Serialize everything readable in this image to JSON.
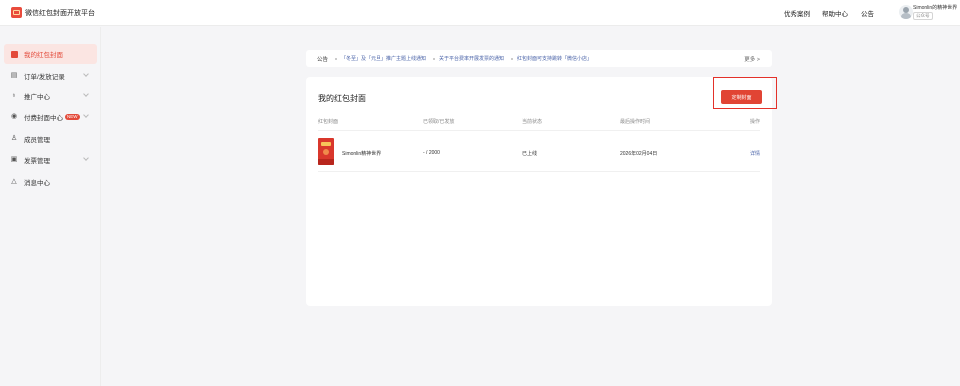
{
  "header": {
    "brand": "微信红包封面开放平台",
    "nav": [
      "优秀案例",
      "帮助中心",
      "公告"
    ],
    "user": {
      "name": "Simonlin的精神世界",
      "tag": "公众号"
    }
  },
  "sidebar": {
    "items": [
      {
        "label": "我的红包封面",
        "icon": "red-packet-icon",
        "active": true
      },
      {
        "label": "订单/发放记录",
        "icon": "document-icon",
        "expandable": true
      },
      {
        "label": "推广中心",
        "icon": "promo-icon",
        "expandable": true
      },
      {
        "label": "付费封面中心",
        "icon": "coin-icon",
        "expandable": true,
        "badge": "NEW"
      },
      {
        "label": "成员管理",
        "icon": "members-icon"
      },
      {
        "label": "发票管理",
        "icon": "invoice-icon",
        "expandable": true
      },
      {
        "label": "消息中心",
        "icon": "bell-icon"
      }
    ]
  },
  "notice": {
    "label": "公告",
    "items": [
      "「冬至」及「元旦」推广主题上线通知",
      "关于平台费率开展发票的通知",
      "红包封面可支持跳转「微信小店」"
    ],
    "more": "更多 >"
  },
  "main": {
    "title": "我的红包封面",
    "create_button": "定制封面",
    "columns": [
      "红包封面",
      "已领取/已发放",
      "当前状态",
      "最后操作时间",
      "操作"
    ],
    "rows": [
      {
        "name": "Simonlin精神世界",
        "claimed": "- / 2000",
        "status": "已上线",
        "time": "2026年02月04日",
        "action": "详情"
      }
    ]
  },
  "colors": {
    "accent": "#e14434",
    "link": "#4a63a8",
    "active_bg": "#fbe5e2"
  }
}
